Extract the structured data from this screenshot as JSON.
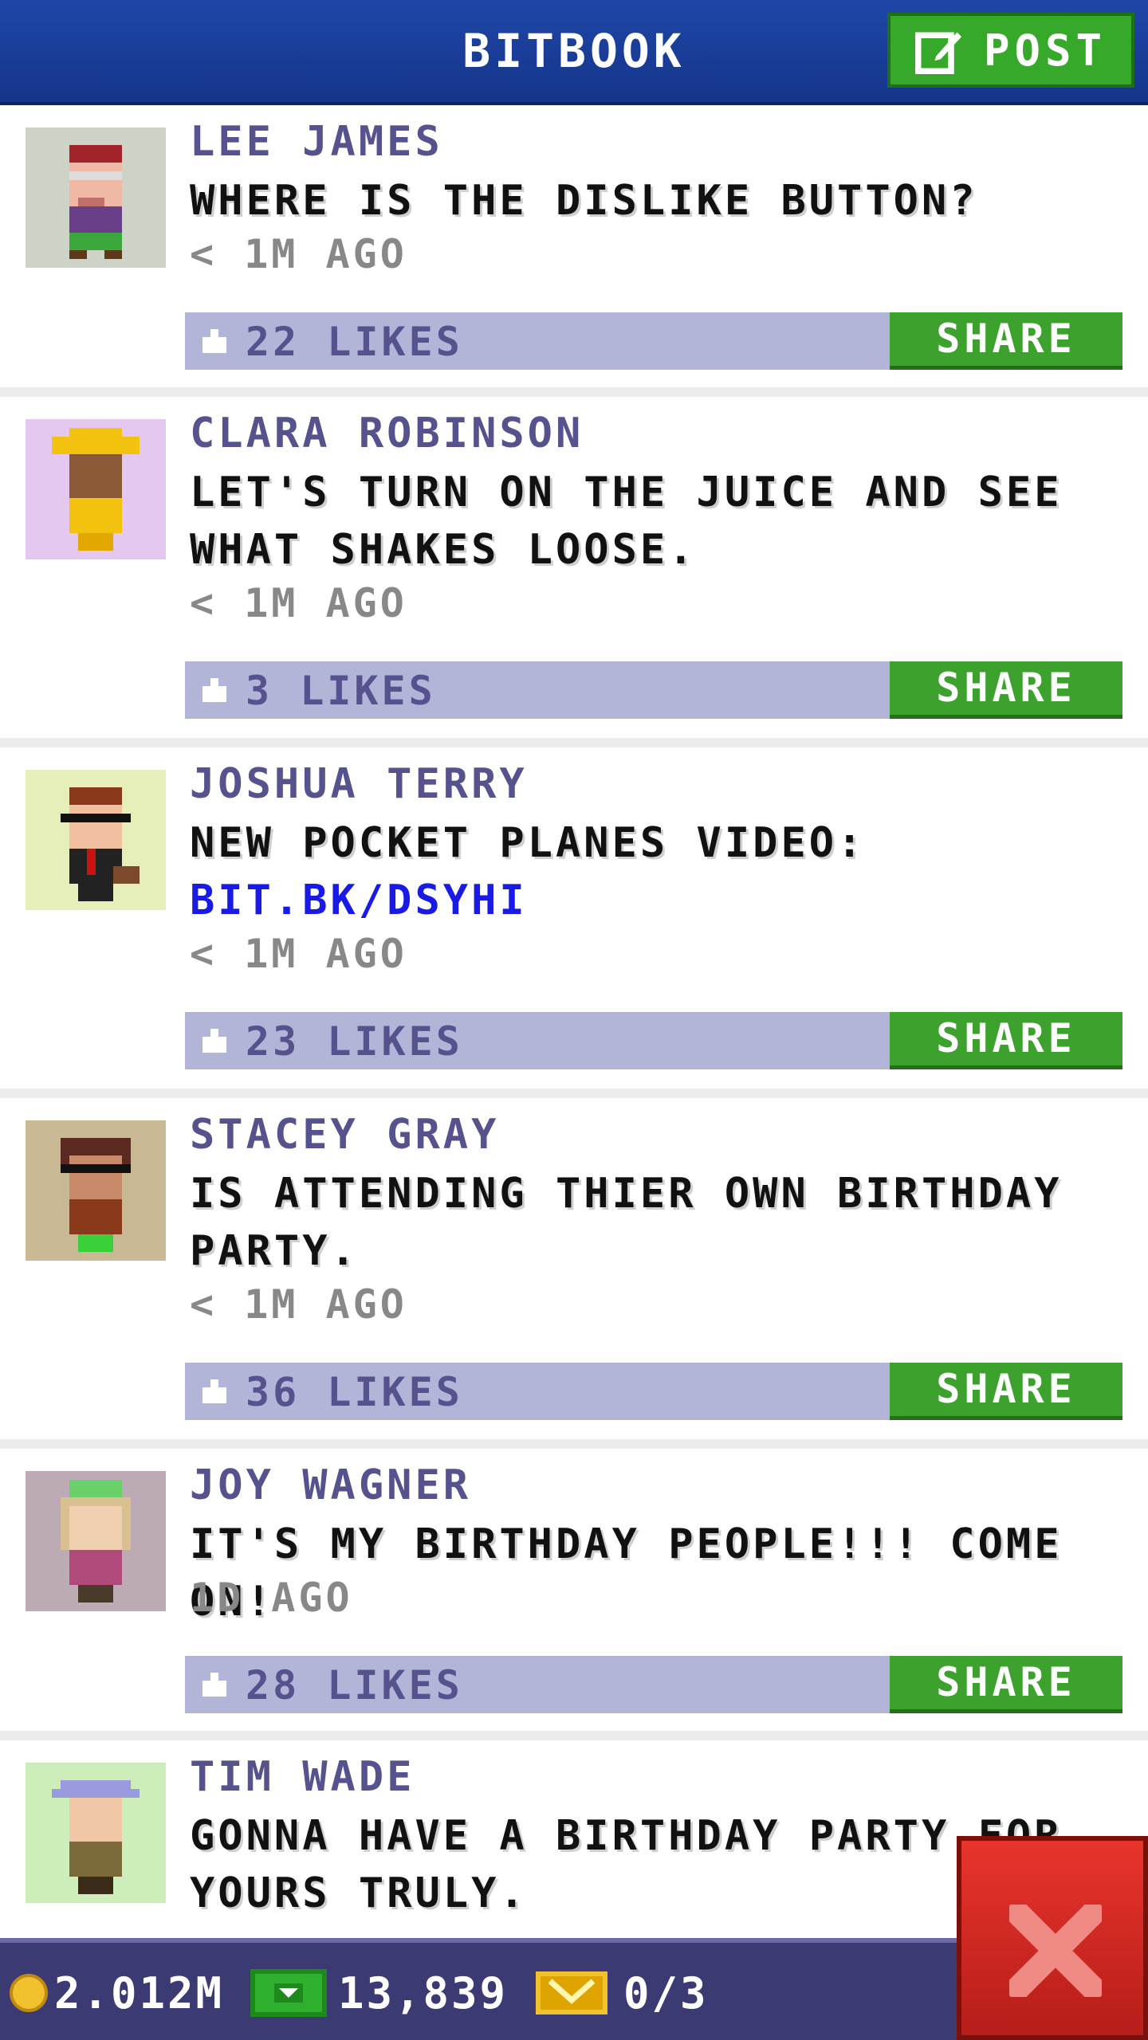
{
  "header": {
    "title": "BITBOOK",
    "post_label": "POST"
  },
  "posts": [
    {
      "author": "LEE JAMES",
      "message": "WHERE IS THE DISLIKE BUTTON?",
      "time": "< 1M AGO",
      "likes": "22 LIKES",
      "share_label": "SHARE",
      "avatar_bg": "#cdd3c6"
    },
    {
      "author": "CLARA ROBINSON",
      "message": "LET'S TURN ON THE JUICE AND SEE WHAT SHAKES LOOSE.",
      "time": "< 1M AGO",
      "likes": "3 LIKES",
      "share_label": "SHARE",
      "avatar_bg": "#e4c8ef"
    },
    {
      "author": "JOSHUA TERRY",
      "message": "NEW POCKET PLANES VIDEO:",
      "link": "BIT.BK/DSYHI",
      "time": "< 1M AGO",
      "likes": "23 LIKES",
      "share_label": "SHARE",
      "avatar_bg": "#e6efb9"
    },
    {
      "author": "STACEY GRAY",
      "message": "IS ATTENDING THIER OWN BIRTHDAY PARTY.",
      "time": "< 1M AGO",
      "likes": "36 LIKES",
      "share_label": "SHARE",
      "avatar_bg": "#c8b894"
    },
    {
      "author": "JOY WAGNER",
      "message": "IT'S MY BIRTHDAY PEOPLE!!! COME ON!",
      "time": "1D AGO",
      "likes": "28 LIKES",
      "share_label": "SHARE",
      "avatar_bg": "#bcaab4"
    },
    {
      "author": "TIM WADE",
      "message": "GONNA HAVE A BIRTHDAY PARTY FOR YOURS TRULY.",
      "avatar_bg": "#cdeebb"
    }
  ],
  "status": {
    "coins": "2.012M",
    "bux": "13,839",
    "tickets": "0/3"
  },
  "colors": {
    "header": "#1e47a8",
    "post_button": "#36a82a",
    "share_button": "#3da12e",
    "like_bar": "#b3b5d8",
    "author": "#56528e",
    "link": "#1a1ae6",
    "status_bar": "#3c3a72",
    "close": "#e8342c"
  },
  "icons": {
    "post": "edit-icon",
    "like": "thumbs-up-icon",
    "coin": "coin-icon",
    "bux": "bux-icon",
    "ticket": "ticket-icon",
    "close": "close-icon"
  }
}
